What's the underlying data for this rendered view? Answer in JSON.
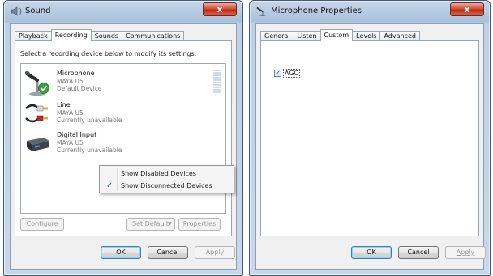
{
  "sound": {
    "title": "Sound",
    "tabs": [
      {
        "label": "Playback"
      },
      {
        "label": "Recording"
      },
      {
        "label": "Sounds"
      },
      {
        "label": "Communications"
      }
    ],
    "instruction": "Select a recording device below to modify its settings:",
    "devices": [
      {
        "name": "Microphone",
        "line1": "MAYA U5",
        "line2": "Default Device"
      },
      {
        "name": "Line",
        "line1": "MAYA U5",
        "line2": "Currently unavailable"
      },
      {
        "name": "Digital Input",
        "line1": "MAYA U5",
        "line2": "Currently unavailable"
      }
    ],
    "context_menu": [
      {
        "label": "Show Disabled Devices",
        "checked": false
      },
      {
        "label": "Show Disconnected Devices",
        "checked": true
      }
    ],
    "buttons": {
      "configure": "Configure",
      "set_default": "Set Default",
      "properties": "Properties",
      "ok": "OK",
      "cancel": "Cancel",
      "apply": "Apply"
    },
    "checkmark": "✓"
  },
  "mic": {
    "title": "Microphone Properties",
    "tabs": [
      {
        "label": "General"
      },
      {
        "label": "Listen"
      },
      {
        "label": "Custom"
      },
      {
        "label": "Levels"
      },
      {
        "label": "Advanced"
      }
    ],
    "agc_label": "AGC",
    "agc_checked": true,
    "checkmark": "✓",
    "buttons": {
      "ok": "OK",
      "cancel": "Cancel",
      "apply": "Apply"
    }
  },
  "window_controls": {
    "close_glyph": "x"
  },
  "colors": {
    "selection_check": "#1f5fb4",
    "mic_check": "#32a852"
  }
}
